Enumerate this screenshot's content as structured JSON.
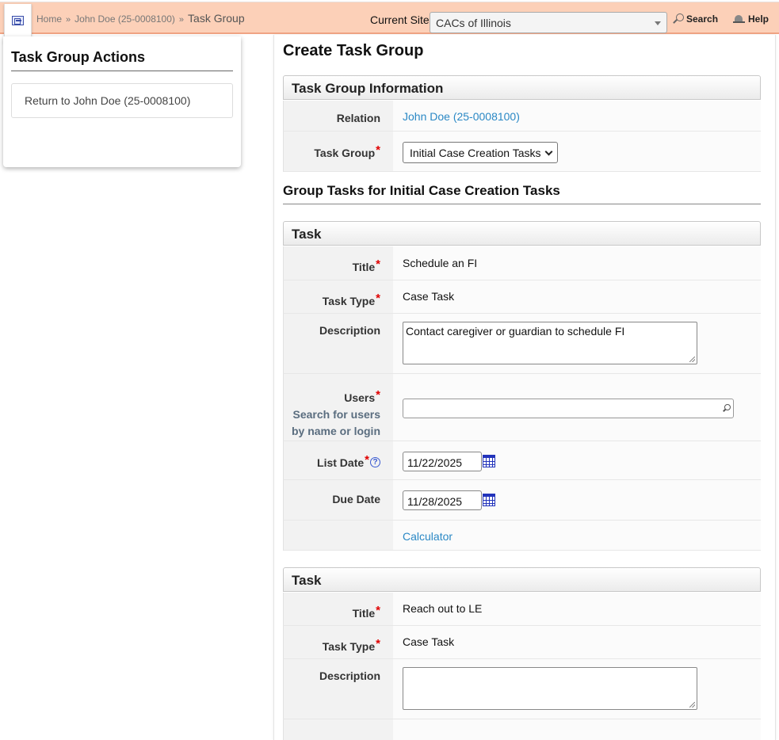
{
  "topbar": {
    "breadcrumbs": [
      "Home",
      "John Doe (25-0008100)"
    ],
    "breadcrumb_current": "Task Group",
    "breadcrumb_separator": "»",
    "site_label": "Current Site",
    "site_value": "CACs of Illinois",
    "search_label": "Search",
    "help_label": "Help"
  },
  "sidebar": {
    "title": "Task Group Actions",
    "actions": [
      "Return to John Doe (25-0008100)"
    ]
  },
  "main": {
    "title": "Create Task Group",
    "info_section": {
      "heading": "Task Group Information",
      "relation_label": "Relation",
      "relation_value": "John Doe (25-0008100)",
      "task_group_label": "Task Group",
      "task_group_value": "Initial Case Creation Tasks"
    },
    "group_tasks_title": "Group Tasks for Initial Case Creation Tasks",
    "tasks": [
      {
        "heading": "Task",
        "title_label": "Title",
        "title_value": "Schedule an FI",
        "type_label": "Task Type",
        "type_value": "Case Task",
        "description_label": "Description",
        "description_value": "Contact caregiver or guardian to schedule FI",
        "users_label": "Users",
        "users_hint_1": "Search for users",
        "users_hint_2": "by name or login",
        "users_value": "",
        "list_date_label": "List Date",
        "list_date_value": "11/22/2025",
        "due_date_label": "Due Date",
        "due_date_value": "11/28/2025",
        "calculator_label": "Calculator"
      },
      {
        "heading": "Task",
        "title_label": "Title",
        "title_value": "Reach out to LE",
        "type_label": "Task Type",
        "type_value": "Case Task",
        "description_label": "Description",
        "description_value": ""
      }
    ],
    "required_mark": "*",
    "help_mark": "?"
  },
  "colors": {
    "topbar_bg": "#fcd0b8",
    "link": "#2a88c5",
    "required": "#e00000"
  }
}
